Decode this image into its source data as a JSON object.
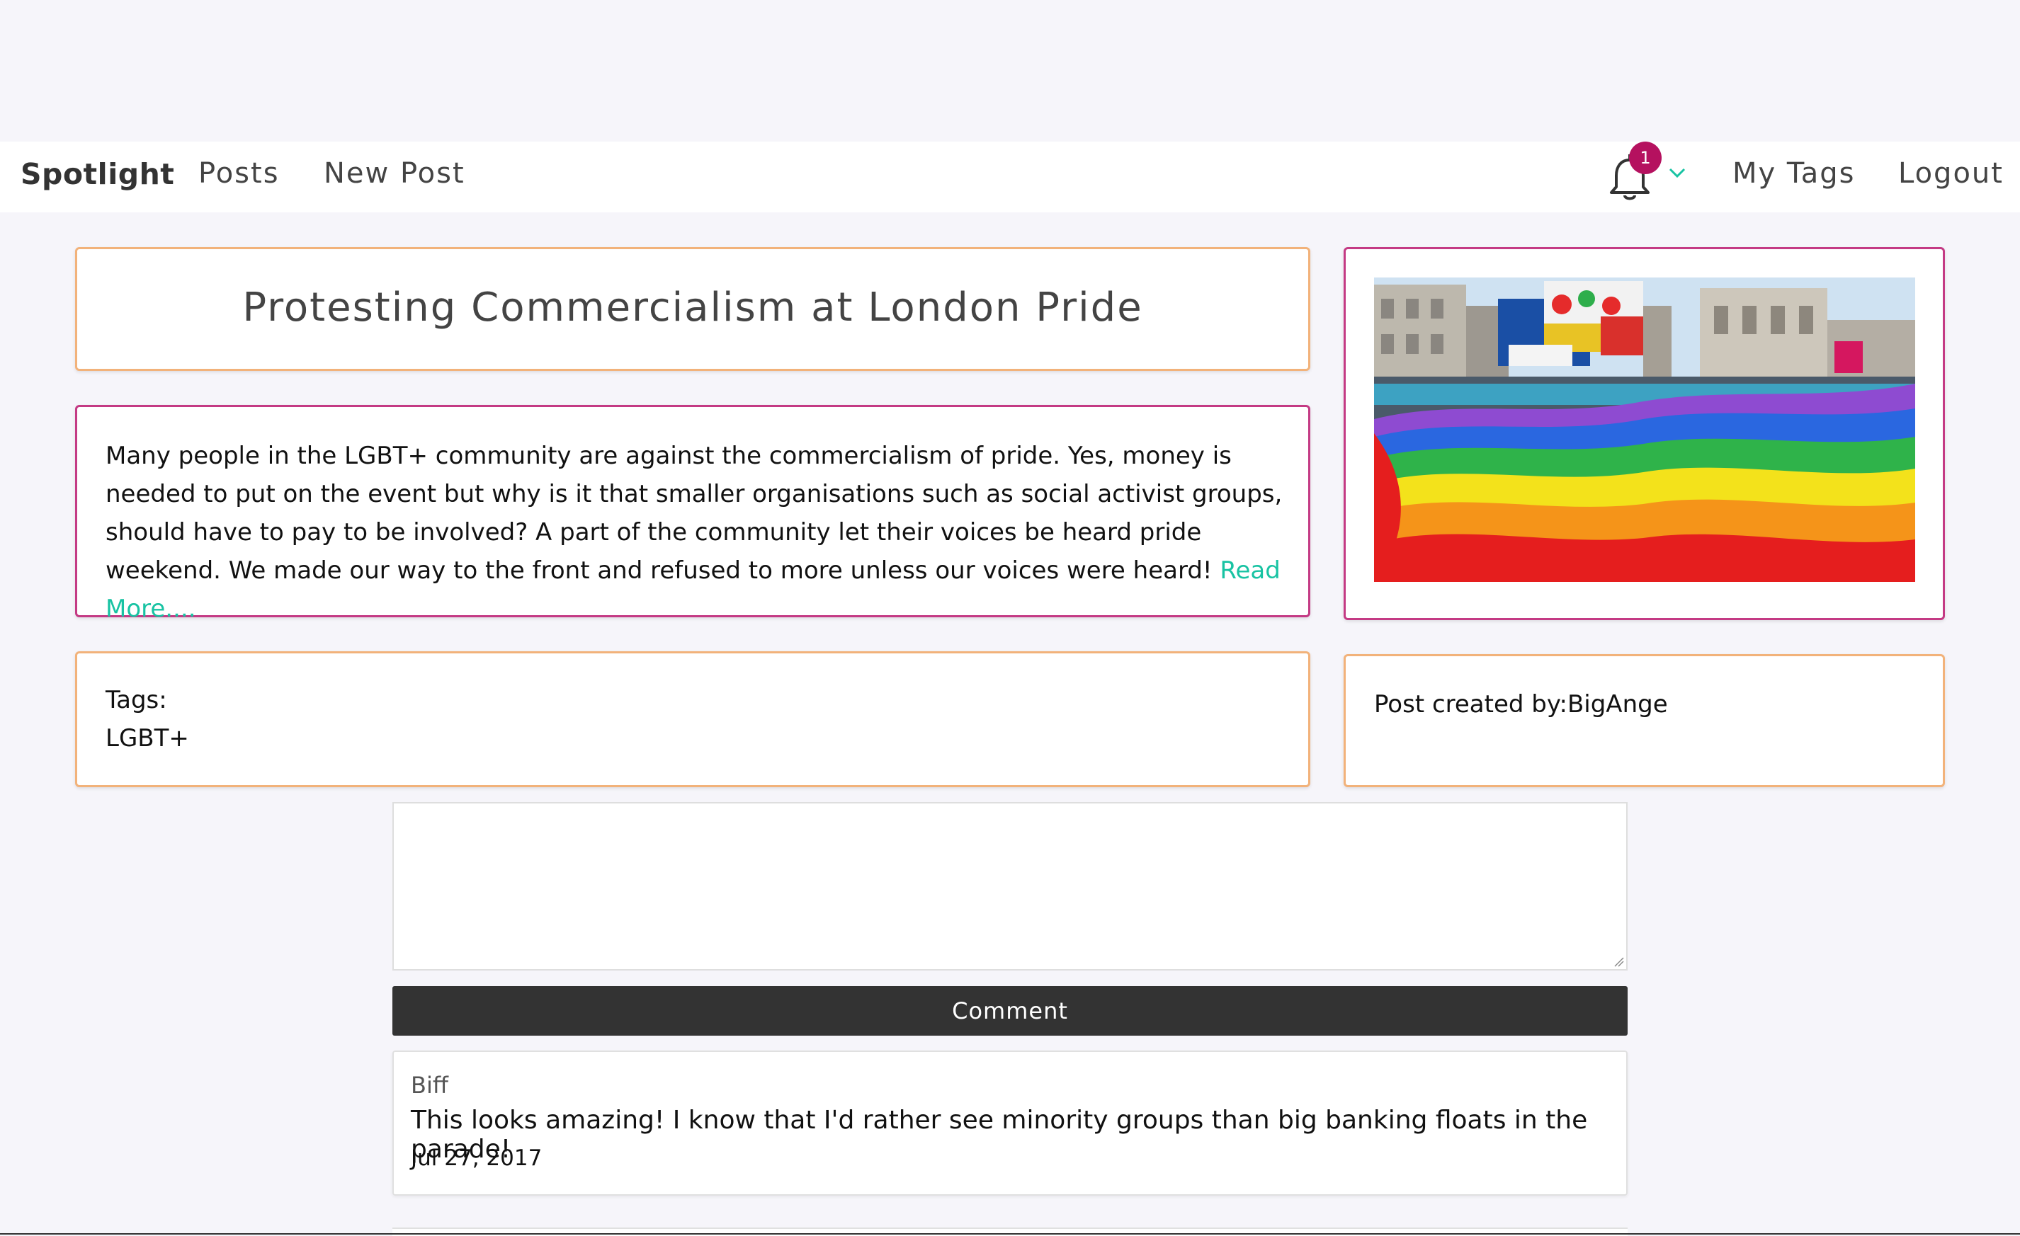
{
  "navbar": {
    "brand": "Spotlight",
    "links": [
      "Posts",
      "New Post"
    ],
    "notifications": {
      "count": "1",
      "icon": "bell-icon"
    },
    "right_links": [
      "My Tags",
      "Logout"
    ]
  },
  "post": {
    "title": "Protesting Commercialism at London Pride",
    "body": "Many people in the LGBT+ community are against the commercialism of pride. Yes, money is needed to put on the event but why is it that smaller organisations such as social activist groups, should have to pay to be involved? A part of the community let their voices be heard pride weekend. We made our way to the front and refused to more unless our voices were heard! ",
    "read_more": "Read More....",
    "tags_label": "Tags:",
    "tags": [
      "LGBT+"
    ],
    "creator_label": "Post created by:",
    "creator": "BigAnge"
  },
  "comment_form": {
    "value": "",
    "button_label": "Comment"
  },
  "comments": [
    {
      "author": "Biff",
      "text": "This looks amazing! I know that I'd rather see minority groups than big banking floats in the parade!",
      "date": "Jul 27, 2017"
    }
  ],
  "colors": {
    "accent": "#18c3a3",
    "badge": "#b5115f",
    "card_border_orange": "#f2b27a",
    "card_border_magenta": "#c43a84",
    "button_bg": "#333333"
  }
}
